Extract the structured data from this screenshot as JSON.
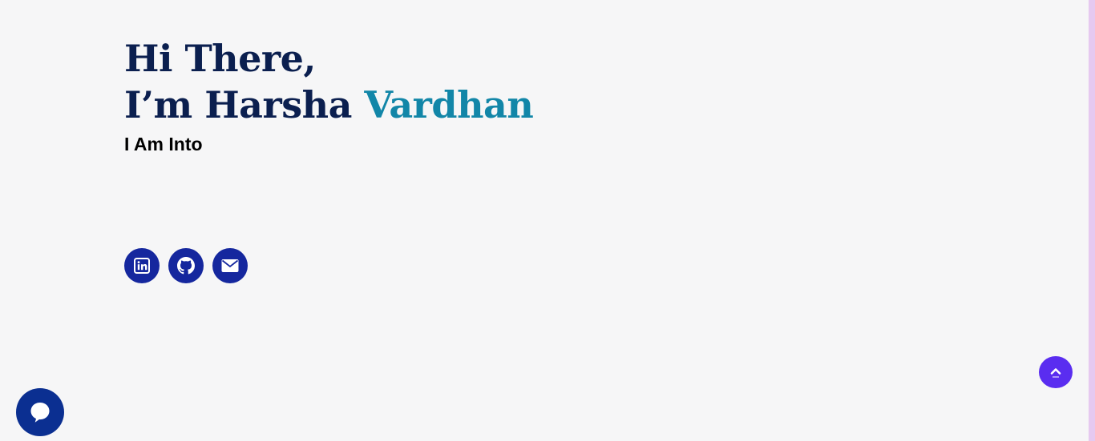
{
  "hero": {
    "greeting": "Hi There,",
    "intro": "I’m Harsha ",
    "name_highlight": "Vardhan",
    "subtitle": "I Am Into"
  },
  "socials": [
    {
      "name": "linkedin",
      "icon": "linkedin-icon"
    },
    {
      "name": "github",
      "icon": "github-icon"
    },
    {
      "name": "email",
      "icon": "envelope-icon"
    }
  ],
  "widgets": {
    "chat_icon": "chat-bubble-icon",
    "scroll_top_icon": "chevron-up-icon"
  },
  "colors": {
    "background": "#f6f6f7",
    "heading": "#0b1f4f",
    "accent": "#1286a8",
    "social_button": "#15279e",
    "chat_button": "#0b2f91",
    "scroll_top_button": "#5a2df0",
    "scrollbar_strip": "#e6c9f0"
  }
}
